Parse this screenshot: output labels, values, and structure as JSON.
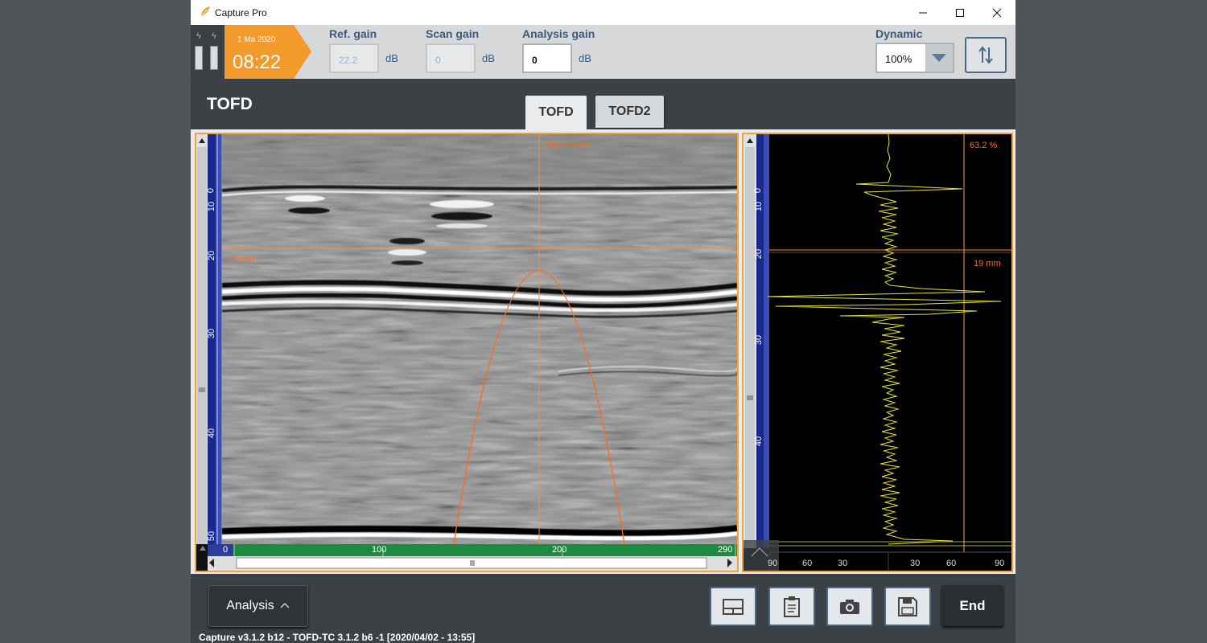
{
  "window": {
    "title": "Capture Pro"
  },
  "header": {
    "date": "1 Ma 2020",
    "time": "08:22",
    "ref_gain": {
      "label": "Ref. gain",
      "value": "22.2",
      "unit": "dB"
    },
    "scan_gain": {
      "label": "Scan gain",
      "value": "0",
      "unit": "dB"
    },
    "analysis_gain": {
      "label": "Analysis gain",
      "value": "0",
      "unit": "dB"
    },
    "dynamic": {
      "label": "Dynamic",
      "value": "100%"
    },
    "swap_icon": "up-down-arrows-icon"
  },
  "section_title": "TOFD",
  "tabs": [
    {
      "label": "TOFD",
      "active": true
    },
    {
      "label": "TOFD2",
      "active": false
    }
  ],
  "bscan": {
    "cursor_x_label": "183.69 mm",
    "cursor_y_label": "19 mm",
    "depth_ticks": [
      "0",
      "10",
      "20",
      "30",
      "40",
      "50"
    ],
    "scan_ticks": [
      "0",
      "100",
      "200",
      "290"
    ]
  },
  "ascan": {
    "amplitude_label": "63.2 %",
    "cursor_y_label": "19 mm",
    "depth_ticks": [
      "0",
      "10",
      "20",
      "30",
      "40"
    ],
    "amp_ticks": [
      "90",
      "60",
      "30",
      "30",
      "60",
      "90"
    ]
  },
  "bottom": {
    "analysis_label": "Analysis",
    "end_label": "End",
    "icons": [
      "layout-icon",
      "clipboard-icon",
      "camera-icon",
      "save-icon"
    ],
    "status": "Capture v3.1.2 b12 - TOFD-TC 3.1.2 b6 -1 [2020/04/02 - 13:55]"
  },
  "colors": {
    "accent": "#f3a13a",
    "cursor": "#ff8c3a",
    "trace": "#e6e635",
    "gain_label": "#3d5a7a"
  }
}
